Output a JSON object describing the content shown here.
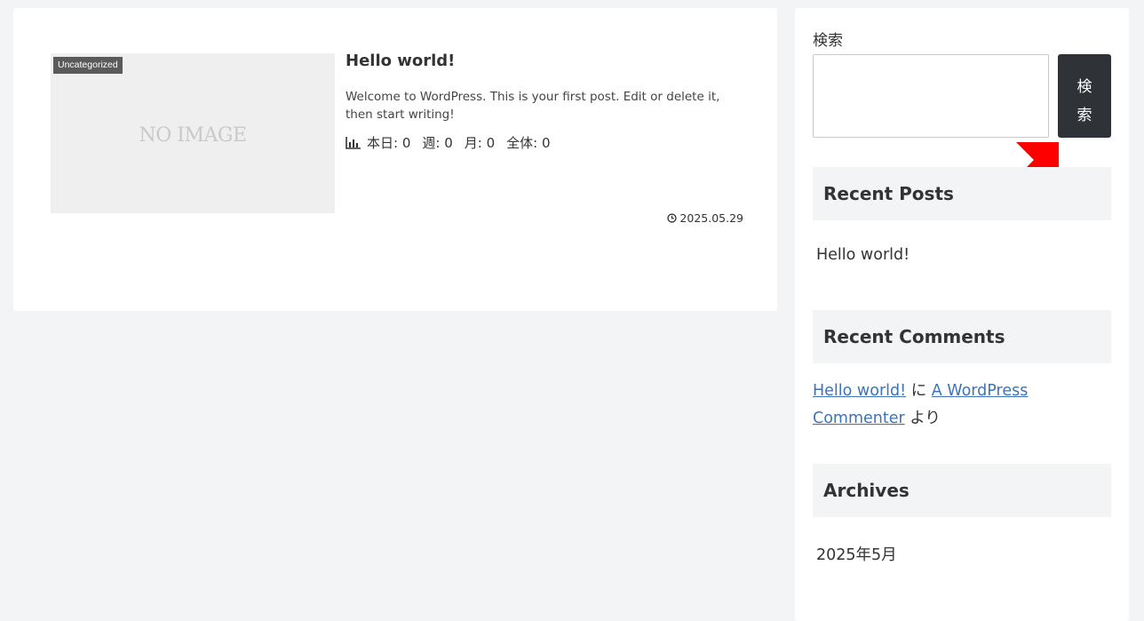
{
  "post": {
    "category": "Uncategorized",
    "thumbnail_text": "NO IMAGE",
    "title": "Hello world!",
    "excerpt": "Welcome to WordPress. This is your first post. Edit or delete it, then start writing!",
    "stats": {
      "today": "本日: 0",
      "week": "週: 0",
      "month": "月: 0",
      "total": "全体: 0"
    },
    "date": "2025.05.29"
  },
  "sidebar": {
    "search": {
      "label": "検索",
      "input_value": "",
      "button_label": "検索"
    },
    "recent_posts": {
      "title": "Recent Posts",
      "items": [
        "Hello world!"
      ]
    },
    "recent_comments": {
      "title": "Recent Comments",
      "post_link": "Hello world!",
      "ni": " に ",
      "author_link": "A WordPress Commenter",
      "yori": " より"
    },
    "archives": {
      "title": "Archives",
      "items": [
        "2025年5月"
      ]
    }
  },
  "colors": {
    "page_background": "#f3f4f6",
    "card_background": "#ffffff",
    "search_button": "#2f3338",
    "link": "#3d73b8",
    "annotation_arrow": "#ff0000"
  },
  "icons": {
    "stats": "bar-chart-icon",
    "date": "clock-icon",
    "annotation": "red-arrow-icon"
  }
}
